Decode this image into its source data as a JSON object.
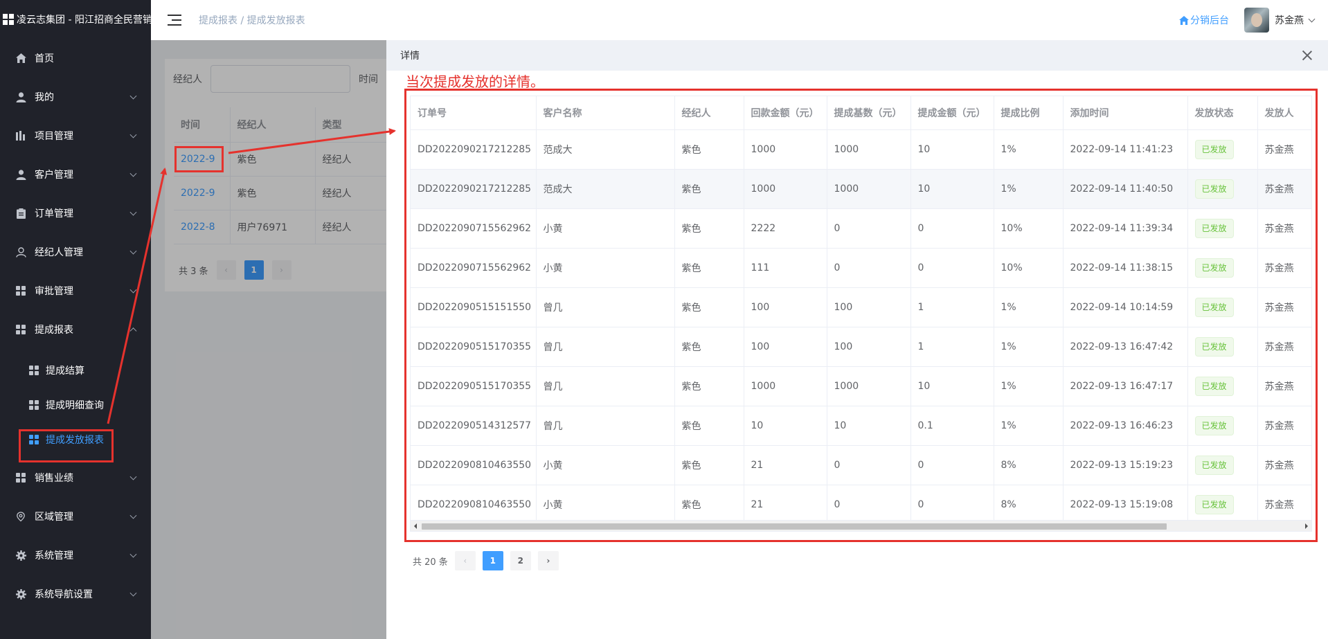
{
  "sidebar": {
    "logo": "凌云志集团 - 阳江招商全民营销",
    "items": [
      {
        "label": "首页",
        "icon": "home-icon"
      },
      {
        "label": "我的",
        "icon": "user-icon"
      },
      {
        "label": "项目管理",
        "icon": "chart-icon"
      },
      {
        "label": "客户管理",
        "icon": "user-icon"
      },
      {
        "label": "订单管理",
        "icon": "clipboard-icon"
      },
      {
        "label": "经纪人管理",
        "icon": "user-outline-icon"
      },
      {
        "label": "审批管理",
        "icon": "grid-icon"
      },
      {
        "label": "提成报表",
        "icon": "grid-icon"
      }
    ],
    "subitems": [
      {
        "label": "提成结算"
      },
      {
        "label": "提成明细查询"
      },
      {
        "label": "提成发放报表"
      }
    ],
    "items_after": [
      {
        "label": "销售业绩",
        "icon": "grid-icon"
      },
      {
        "label": "区域管理",
        "icon": "location-icon"
      },
      {
        "label": "系统管理",
        "icon": "gear-icon"
      },
      {
        "label": "系统导航设置",
        "icon": "gear-icon"
      }
    ]
  },
  "header": {
    "breadcrumb": "提成报表 / 提成发放报表",
    "backend_link": "分销后台",
    "username": "苏金燕"
  },
  "filters": {
    "agent_label": "经纪人",
    "time_label": "时间"
  },
  "bg_table": {
    "columns": [
      "时间",
      "经纪人",
      "类型"
    ],
    "rows": [
      [
        "2022-9",
        "紫色",
        "经纪人"
      ],
      [
        "2022-9",
        "紫色",
        "经纪人"
      ],
      [
        "2022-8",
        "用户76971",
        "经纪人"
      ]
    ]
  },
  "bg_pager": {
    "total": "共 3 条",
    "current": "1"
  },
  "drawer": {
    "title": "详情",
    "annotation": "当次提成发放的详情。",
    "columns": [
      "订单号",
      "客户名称",
      "经纪人",
      "回款金额（元）",
      "提成基数（元）",
      "提成金额（元）",
      "提成比例",
      "添加时间",
      "发放状态",
      "发放人"
    ],
    "rows": [
      [
        "DD2022090217212285",
        "范成大",
        "紫色",
        "1000",
        "1000",
        "10",
        "1%",
        "2022-09-14 11:41:23",
        "已发放",
        "苏金燕"
      ],
      [
        "DD2022090217212285",
        "范成大",
        "紫色",
        "1000",
        "1000",
        "10",
        "1%",
        "2022-09-14 11:40:50",
        "已发放",
        "苏金燕"
      ],
      [
        "DD2022090715562962",
        "小黄",
        "紫色",
        "2222",
        "0",
        "0",
        "10%",
        "2022-09-14 11:39:34",
        "已发放",
        "苏金燕"
      ],
      [
        "DD2022090715562962",
        "小黄",
        "紫色",
        "111",
        "0",
        "0",
        "10%",
        "2022-09-14 11:38:15",
        "已发放",
        "苏金燕"
      ],
      [
        "DD2022090515151550",
        "曾几",
        "紫色",
        "100",
        "100",
        "1",
        "1%",
        "2022-09-14 10:14:59",
        "已发放",
        "苏金燕"
      ],
      [
        "DD2022090515170355",
        "曾几",
        "紫色",
        "100",
        "100",
        "1",
        "1%",
        "2022-09-13 16:47:42",
        "已发放",
        "苏金燕"
      ],
      [
        "DD2022090515170355",
        "曾几",
        "紫色",
        "1000",
        "1000",
        "10",
        "1%",
        "2022-09-13 16:47:17",
        "已发放",
        "苏金燕"
      ],
      [
        "DD2022090514312577",
        "曾几",
        "紫色",
        "10",
        "10",
        "0.1",
        "1%",
        "2022-09-13 16:46:23",
        "已发放",
        "苏金燕"
      ],
      [
        "DD2022090810463550",
        "小黄",
        "紫色",
        "21",
        "0",
        "0",
        "8%",
        "2022-09-13 15:19:23",
        "已发放",
        "苏金燕"
      ],
      [
        "DD2022090810463550",
        "小黄",
        "紫色",
        "21",
        "0",
        "0",
        "8%",
        "2022-09-13 15:19:08",
        "已发放",
        "苏金燕"
      ]
    ],
    "pager": {
      "total": "共 20 条",
      "pages": [
        "1",
        "2"
      ],
      "current": "1"
    }
  },
  "colors": {
    "accent": "#409eff",
    "sidebar_bg": "#20222a",
    "annotation_red": "#e5322d",
    "success": "#67c23a"
  }
}
